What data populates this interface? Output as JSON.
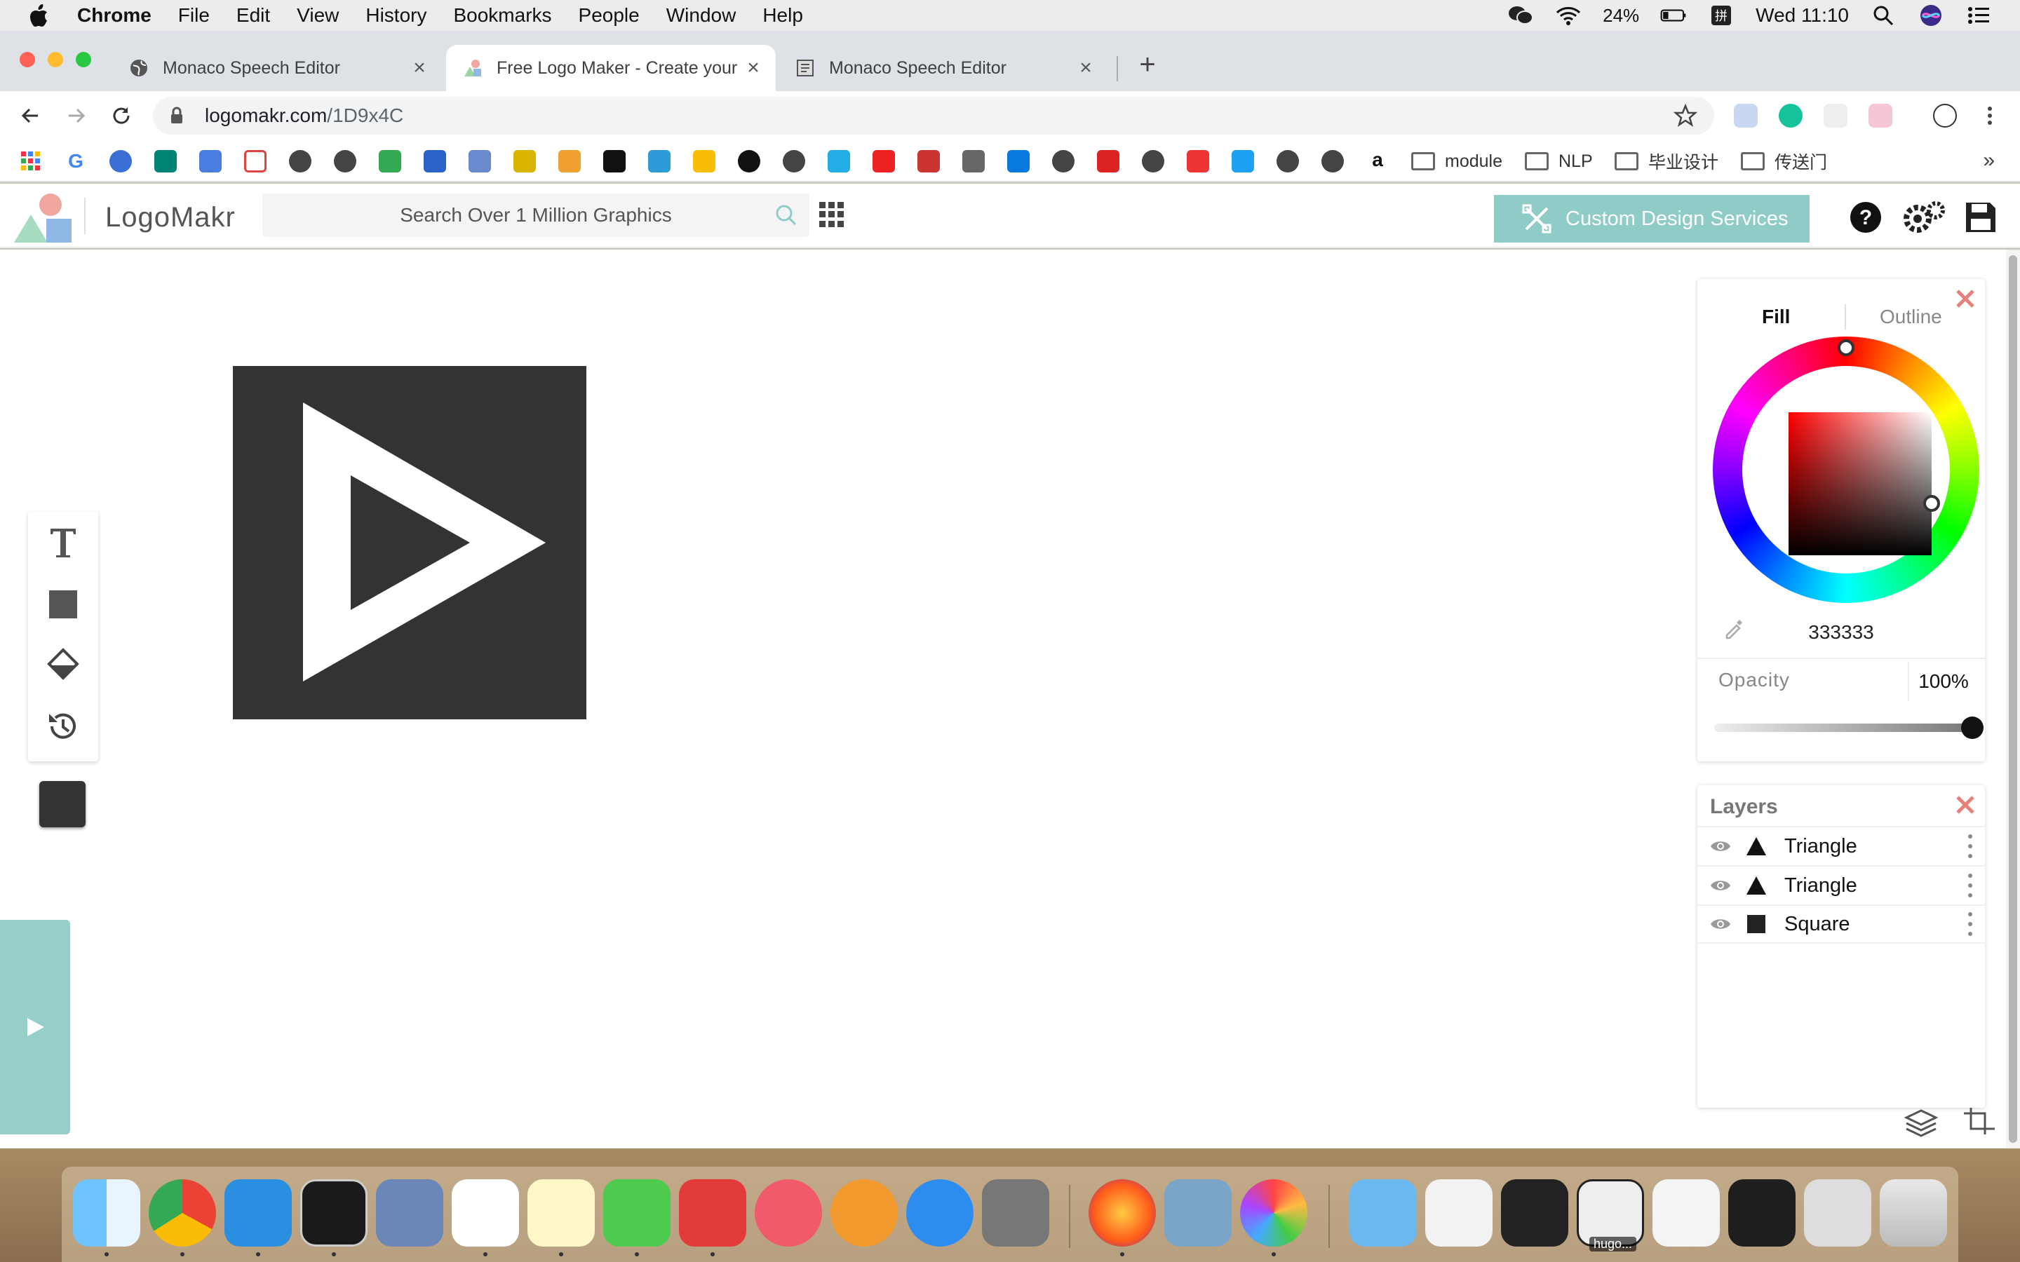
{
  "menubar": {
    "app": "Chrome",
    "items": [
      "File",
      "Edit",
      "View",
      "History",
      "Bookmarks",
      "People",
      "Window",
      "Help"
    ],
    "battery": "24%",
    "clock": "Wed 11:10"
  },
  "tabs": [
    {
      "title": "Monaco Speech Editor",
      "active": false
    },
    {
      "title": "Free Logo Maker - Create your",
      "active": true
    },
    {
      "title": "Monaco Speech Editor",
      "active": false
    }
  ],
  "address": {
    "host": "logomakr.com",
    "path": "/1D9x4C"
  },
  "bookmarks": {
    "folders": [
      "module",
      "NLP",
      "毕业设计",
      "传送门"
    ],
    "more": "»"
  },
  "app": {
    "logo_text": "LogoMakr",
    "search_placeholder": "Search Over 1 Million Graphics",
    "custom_design_label": "Custom Design Services"
  },
  "color_panel": {
    "tab_fill": "Fill",
    "tab_outline": "Outline",
    "hex": "333333",
    "opacity_label": "Opacity",
    "opacity_value": "100%",
    "opacity_level": 1.0,
    "fill_color": "#333333"
  },
  "layers": {
    "title": "Layers",
    "items": [
      {
        "name": "Triangle",
        "shape": "triangle"
      },
      {
        "name": "Triangle",
        "shape": "triangle"
      },
      {
        "name": "Square",
        "shape": "square"
      }
    ]
  },
  "dock": {
    "hugo_label": "hugo..."
  },
  "colors": {
    "accent_teal": "#8fccc8",
    "close_red": "#e8807a",
    "canvas_fill": "#333333"
  }
}
